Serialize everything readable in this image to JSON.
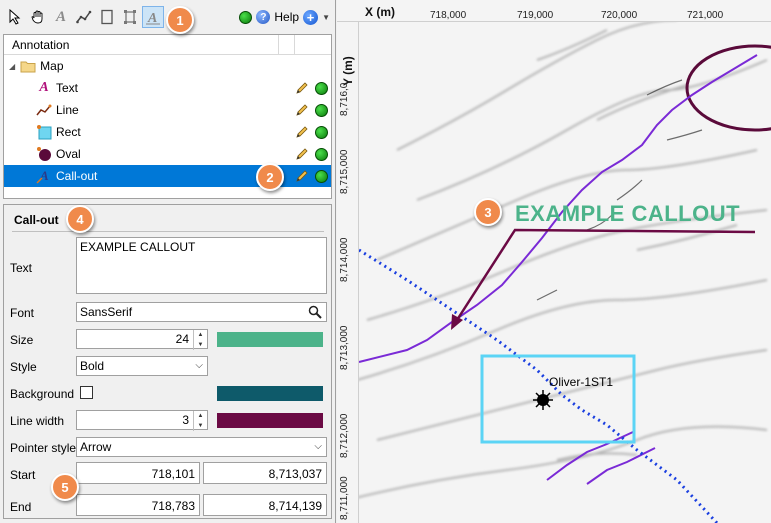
{
  "toolbar": {
    "help_label": "Help"
  },
  "tree": {
    "header": "Annotation",
    "root": "Map",
    "items": [
      {
        "label": "Text",
        "icon": "text-annotation-icon"
      },
      {
        "label": "Line",
        "icon": "line-annotation-icon"
      },
      {
        "label": "Rect",
        "icon": "rect-annotation-icon"
      },
      {
        "label": "Oval",
        "icon": "oval-annotation-icon"
      },
      {
        "label": "Call-out",
        "icon": "callout-annotation-icon",
        "selected": true
      }
    ]
  },
  "props": {
    "title": "Call-out",
    "text_label": "Text",
    "text_value": "EXAMPLE CALLOUT",
    "font_label": "Font",
    "font_value": "SansSerif",
    "size_label": "Size",
    "size_value": "24",
    "size_color": "#4cb38a",
    "style_label": "Style",
    "style_value": "Bold",
    "background_label": "Background",
    "background_color": "#0e5a6a",
    "linewidth_label": "Line width",
    "linewidth_value": "3",
    "linewidth_color": "#6b0a44",
    "pointer_label": "Pointer style",
    "pointer_value": "Arrow",
    "start_label": "Start",
    "start_x": "718,101",
    "start_y": "8,713,037",
    "end_label": "End",
    "end_x": "718,783",
    "end_y": "8,714,139"
  },
  "map": {
    "x_axis_title": "X (m)",
    "y_axis_title": "Y (m)",
    "x_ticks": [
      "718,000",
      "719,000",
      "720,000",
      "721,000"
    ],
    "y_ticks": [
      "8,716,0",
      "8,715,000",
      "8,714,000",
      "8,713,000",
      "8,712,000",
      "8,711,000"
    ],
    "callout_text": "EXAMPLE CALLOUT",
    "well_label": "Oliver-1ST1"
  },
  "badges": [
    "1",
    "2",
    "3",
    "4",
    "5"
  ]
}
